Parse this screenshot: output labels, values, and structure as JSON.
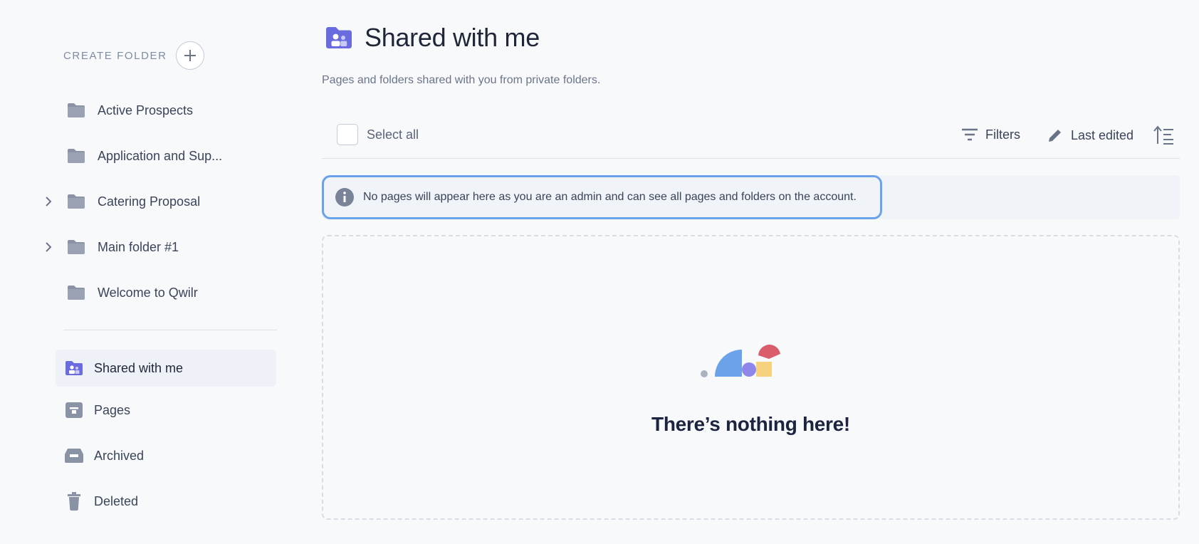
{
  "sidebar": {
    "create_folder_label": "CREATE FOLDER",
    "folders": [
      {
        "label": "Active Prospects",
        "expandable": false
      },
      {
        "label": "Application and Sup...",
        "expandable": false
      },
      {
        "label": "Catering Proposal",
        "expandable": true
      },
      {
        "label": "Main folder #1",
        "expandable": true
      },
      {
        "label": "Welcome to Qwilr",
        "expandable": false
      }
    ],
    "nav": [
      {
        "label": "Shared with me",
        "icon": "shared-folder-icon",
        "active": true
      },
      {
        "label": "Pages",
        "icon": "pages-icon",
        "active": false
      },
      {
        "label": "Archived",
        "icon": "archive-icon",
        "active": false
      },
      {
        "label": "Deleted",
        "icon": "trash-icon",
        "active": false
      }
    ]
  },
  "main": {
    "title": "Shared with me",
    "subtitle": "Pages and folders shared with you from private folders.",
    "toolbar": {
      "select_all_label": "Select all",
      "filters_label": "Filters",
      "sort_label": "Last edited"
    },
    "info_message": "No pages will appear here as you are an admin and can see all pages and folders on the account.",
    "empty_title": "There’s nothing here!"
  },
  "colors": {
    "accent": "#6b6be0",
    "folder_gray": "#8a93a6",
    "info_border": "#6ba2ea"
  }
}
